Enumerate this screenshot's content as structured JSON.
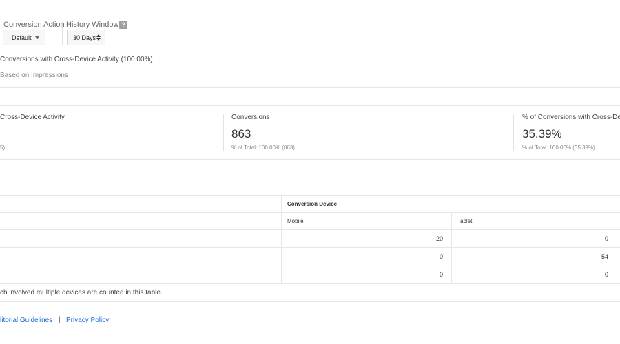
{
  "controls": {
    "conversion_action": {
      "label": "Conversion Action",
      "value": "Default"
    },
    "history_window": {
      "label": "History Window",
      "value": "30 Days"
    },
    "help_glyph": "?"
  },
  "summary": {
    "line1": "Conversions with Cross-Device Activity (100.00%)",
    "line2": "Based on Impressions"
  },
  "cards": [
    {
      "title": "Cross-Device Activity",
      "value": "",
      "sub": "5)"
    },
    {
      "title": "Conversions",
      "value": "863",
      "sub": "% of Total: 100.00% (863)"
    },
    {
      "title": "% of Conversions with Cross-Dev",
      "value": "35.39%",
      "sub": "% of Total: 100.00% (35.39%)"
    }
  ],
  "table": {
    "group_header": "Conversion Device",
    "columns": [
      "Mobile",
      "Tablet"
    ],
    "rows": [
      [
        "20",
        "0"
      ],
      [
        "0",
        "54"
      ],
      [
        "0",
        "0"
      ]
    ]
  },
  "note": "ch involved multiple devices are counted in this table.",
  "footer": {
    "link1": "litorial Guidelines",
    "separator": "|",
    "link2": "Privacy Policy"
  }
}
